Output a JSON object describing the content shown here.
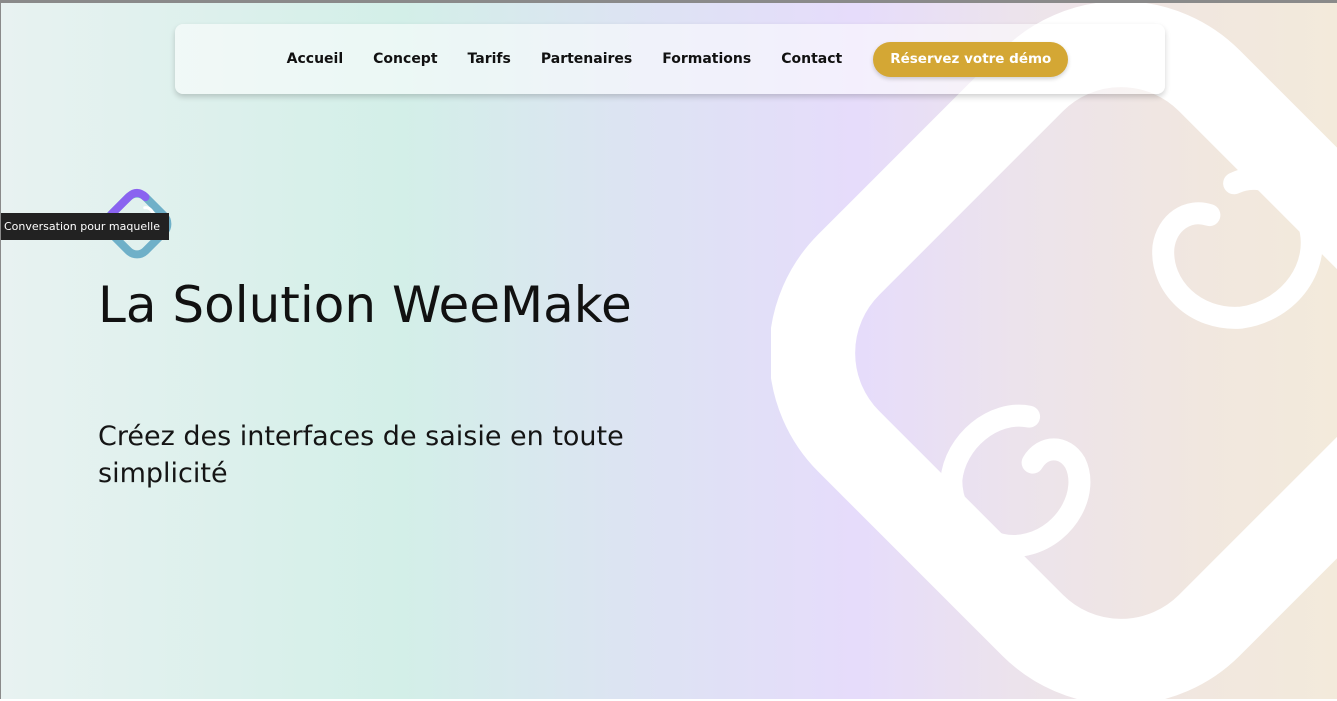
{
  "nav": {
    "links": [
      "Accueil",
      "Concept",
      "Tarifs",
      "Partenaires",
      "Formations",
      "Contact"
    ],
    "cta_label": "Réservez votre démo"
  },
  "tooltip": "Conversation pour maquelle",
  "hero": {
    "title": "La Solution WeeMake",
    "subtitle": "Créez des interfaces de saisie en toute simplicité"
  },
  "colors": {
    "cta": "#d4a734",
    "logo_outer": "#6fb0c8",
    "logo_accent": "#8a63f0",
    "gradient": [
      "#e8f2f1",
      "#d3efe8",
      "#e6dcfb",
      "#f3eadb"
    ]
  },
  "icons": {
    "small_logo": "weemake-logo-icon",
    "background_logo": "weemake-background-logo-icon"
  }
}
